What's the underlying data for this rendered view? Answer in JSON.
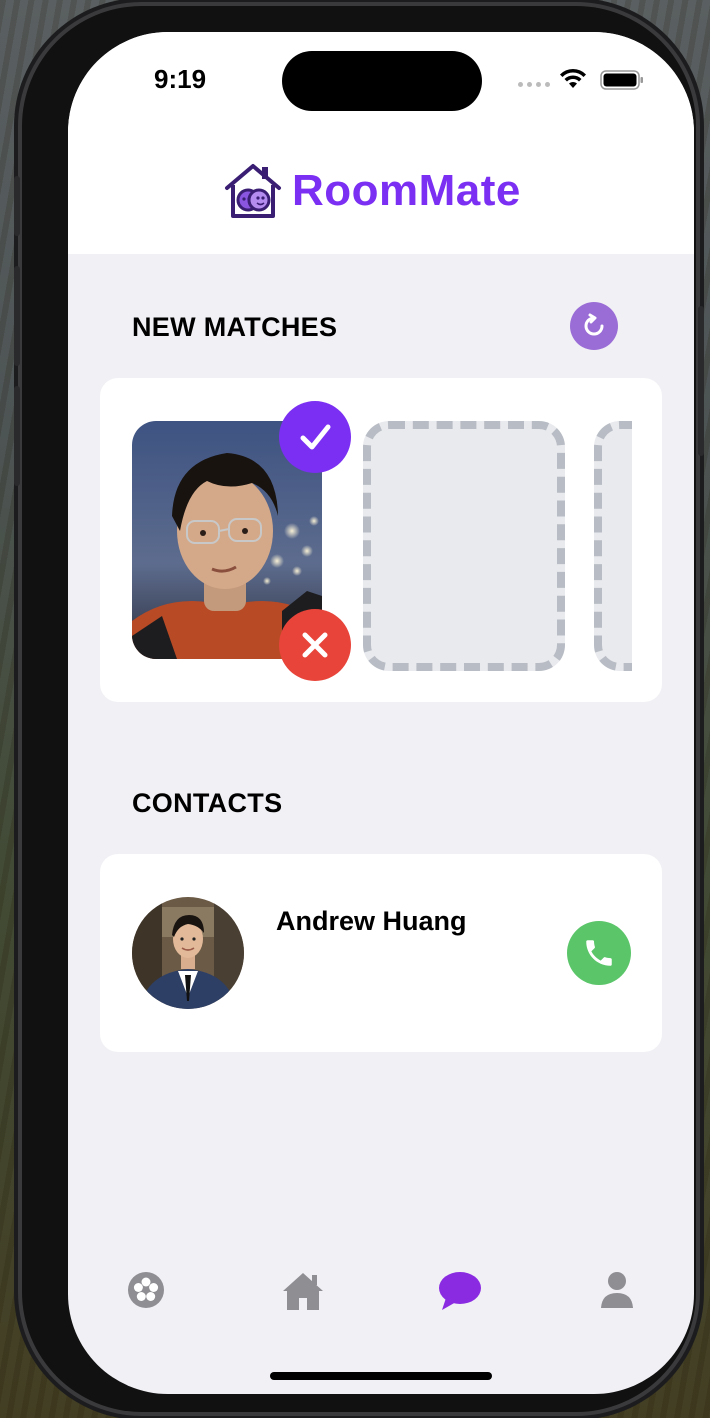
{
  "status_bar": {
    "time": "9:19"
  },
  "header": {
    "app_name": "RoomMate",
    "logo_icon": "house-faces-icon"
  },
  "new_matches": {
    "title": "NEW MATCHES",
    "refresh_icon": "refresh-icon",
    "accept_icon": "checkmark-icon",
    "reject_icon": "close-icon"
  },
  "contacts": {
    "title": "CONTACTS",
    "items": [
      {
        "name": "Andrew Huang",
        "call_icon": "phone-icon"
      }
    ]
  },
  "tab_bar": {
    "items": [
      {
        "icon": "flower-icon",
        "active": false
      },
      {
        "icon": "home-icon",
        "active": false
      },
      {
        "icon": "chat-bubble-icon",
        "active": true
      },
      {
        "icon": "person-icon",
        "active": false
      }
    ]
  },
  "colors": {
    "brand": "#7b2ff2",
    "accept": "#7b2ff2",
    "reject": "#e8443a",
    "call": "#5bc56a",
    "refresh": "#9a6dd6",
    "tab_active": "#8a2be2",
    "tab_inactive": "#8e8e93"
  }
}
